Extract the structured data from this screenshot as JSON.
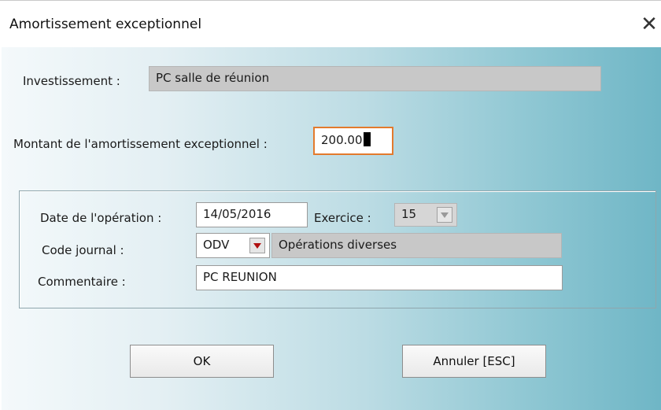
{
  "window": {
    "title": "Amortissement exceptionnel",
    "close_glyph": "✕"
  },
  "investissement": {
    "label": "Investissement :",
    "value": "PC salle de réunion"
  },
  "montant": {
    "label": "Montant de l'amortissement exceptionnel :",
    "value": "200.00"
  },
  "operation": {
    "date_label": "Date de l'opération :",
    "date_value": "14/05/2016",
    "exercice_label": "Exercice :",
    "exercice_value": "15",
    "journal_label": "Code journal :",
    "journal_code": "ODV",
    "journal_name": "Opérations diverses",
    "comment_label": "Commentaire :",
    "comment_value": "PC REUNION"
  },
  "buttons": {
    "ok": "OK",
    "cancel": "Annuler [ESC]"
  },
  "icons": {
    "close": "close-icon",
    "dropdown": "chevron-down-icon"
  },
  "colors": {
    "focus_border": "#e37a2d",
    "dropdown_active": "#b01010",
    "disabled_field": "#c8c8c8"
  }
}
